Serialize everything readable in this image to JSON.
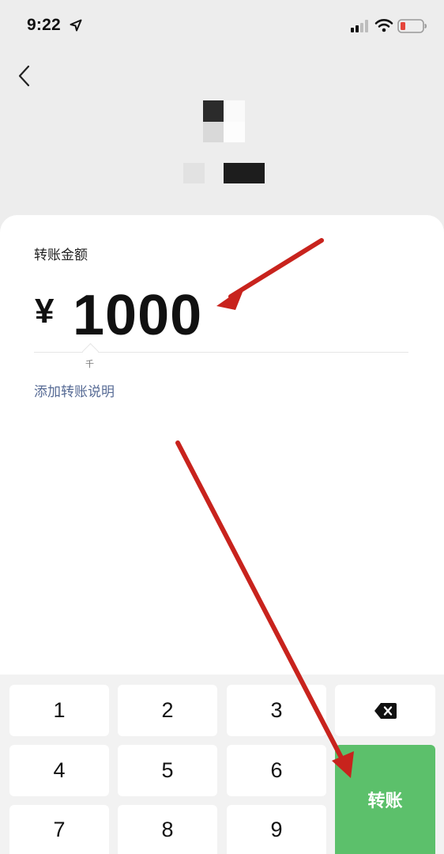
{
  "status_bar": {
    "time": "9:22",
    "icons": [
      "location-arrow-icon",
      "cellular-signal-icon",
      "wifi-icon",
      "battery-low-icon"
    ],
    "battery_color": "#e5453b"
  },
  "header": {
    "back_icon": "chevron-left-icon"
  },
  "transfer": {
    "amount_label": "转账金额",
    "currency_symbol": "¥",
    "amount": "1000",
    "unit_hint": "千",
    "add_note": "添加转账说明"
  },
  "keypad": {
    "keys": [
      "1",
      "2",
      "3",
      "4",
      "5",
      "6",
      "7",
      "8",
      "9"
    ],
    "backspace_icon": "backspace-icon",
    "confirm_label": "转账"
  },
  "colors": {
    "background": "#ededed",
    "card": "#ffffff",
    "link": "#576b95",
    "confirm": "#5cc06b",
    "annotation": "#c8231d"
  }
}
